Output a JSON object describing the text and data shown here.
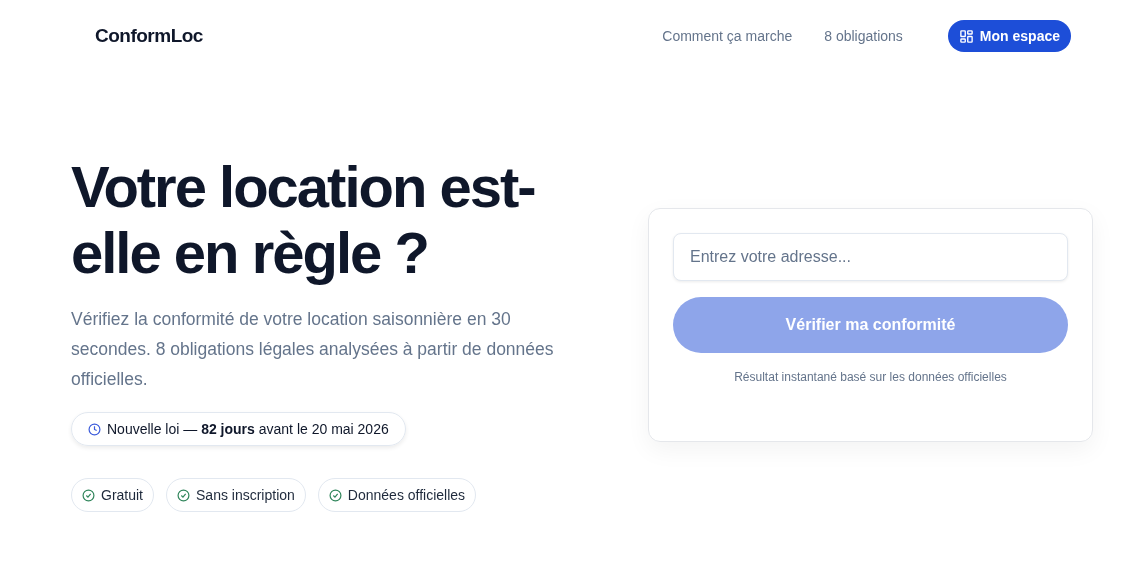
{
  "header": {
    "logo": "ConformLoc",
    "nav": [
      "Comment ça marche",
      "8 obligations"
    ],
    "account_button": "Mon espace"
  },
  "hero": {
    "title": "Votre location est-elle en règle ?",
    "subtitle": "Vérifiez la conformité de votre location saisonnière en 30 secondes. 8 obligations légales analysées à partir de données officielles.",
    "notice": "Nouvelle loi — **82 jours** avant le 20 mai 2026",
    "badges": [
      "Gratuit",
      "Sans inscription",
      "Données officielles"
    ]
  },
  "form": {
    "address": {
      "placeholder": "Entrez votre adresse..."
    },
    "submit": {
      "label": "Vérifier ma conformité",
      "disabled": true
    },
    "note": "Résultat instantané basé sur les données officielles"
  }
}
